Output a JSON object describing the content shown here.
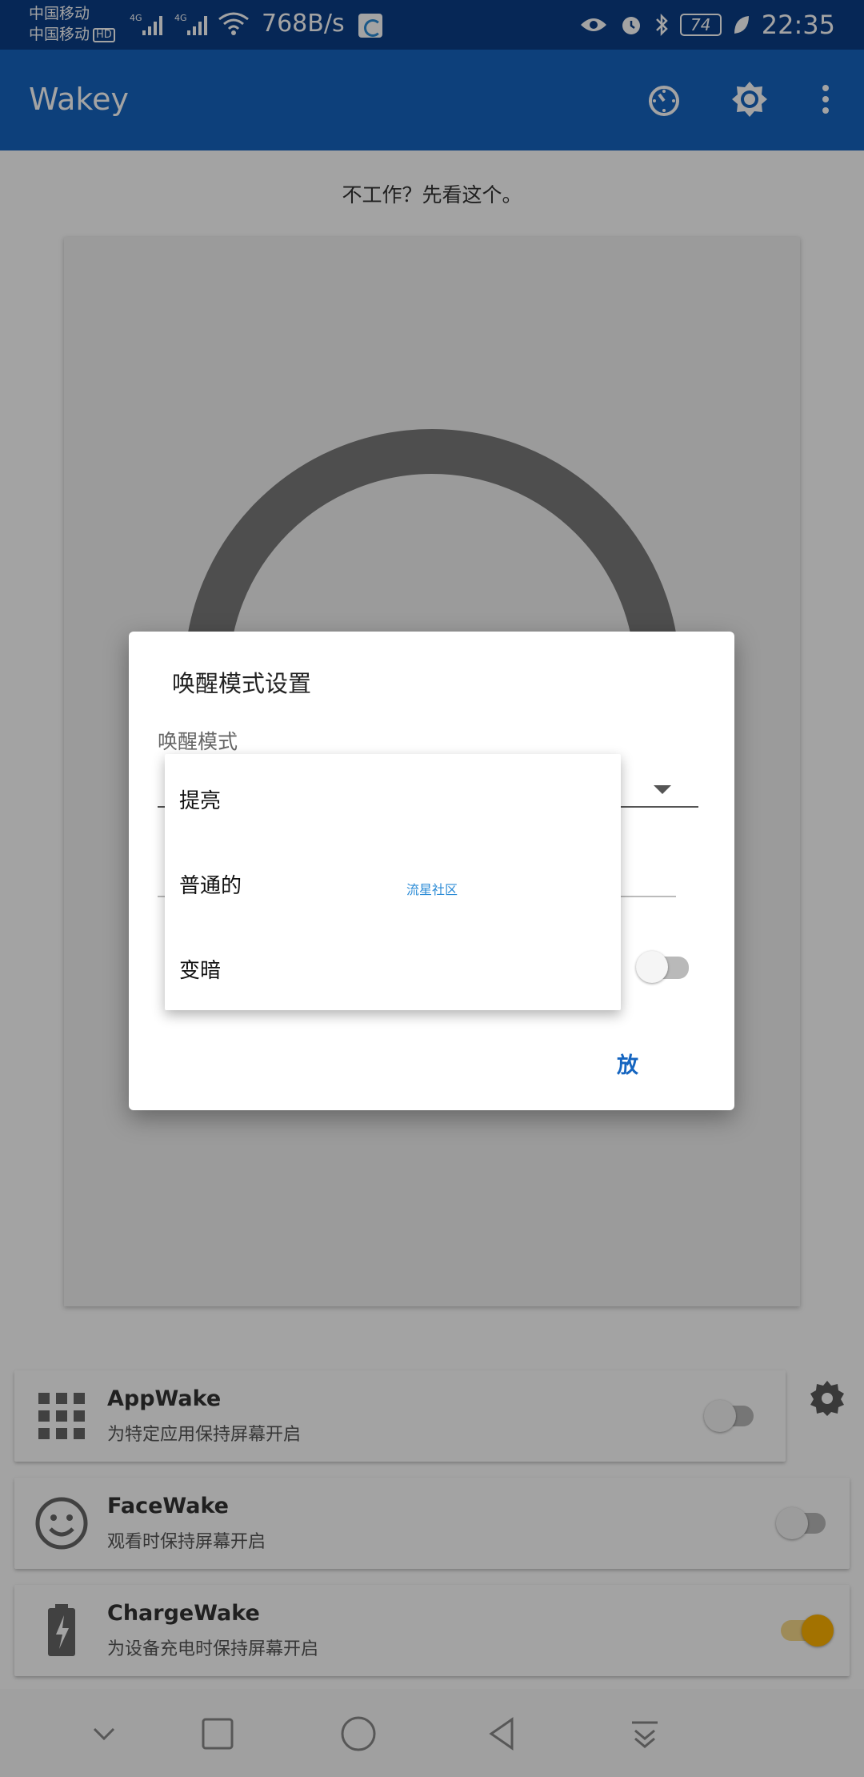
{
  "status_bar": {
    "carrier_1": "中国移动",
    "carrier_2": "中国移动",
    "hd_badge": "HD",
    "net_speed": "768B/s",
    "battery": "74",
    "time": "22:35"
  },
  "app_bar": {
    "title": "Wakey",
    "icons": [
      "timer-icon",
      "brightness-settings-icon",
      "overflow-menu-icon"
    ]
  },
  "hint_link": "不工作？先看这个。",
  "feature_cards": [
    {
      "title": "AppWake",
      "subtitle": "为特定应用保持屏幕开启",
      "icon": "grid-apps-icon",
      "enabled": false
    },
    {
      "title": "FaceWake",
      "subtitle": "观看时保持屏幕开启",
      "icon": "smiley-face-icon",
      "enabled": false
    },
    {
      "title": "ChargeWake",
      "subtitle": "为设备充电时保持屏幕开启",
      "icon": "battery-charging-icon",
      "enabled": true
    }
  ],
  "dialog": {
    "title": "唤醒模式设置",
    "field_label": "唤醒模式",
    "button": "放"
  },
  "dropdown": {
    "options": [
      "提亮",
      "普通的",
      "变暗"
    ]
  },
  "watermark": "流星社区",
  "colors": {
    "status_bar": "#0a3d87",
    "app_bar": "#1565c0",
    "accent": "#1565c0",
    "toggle_on": "#ffb300"
  }
}
